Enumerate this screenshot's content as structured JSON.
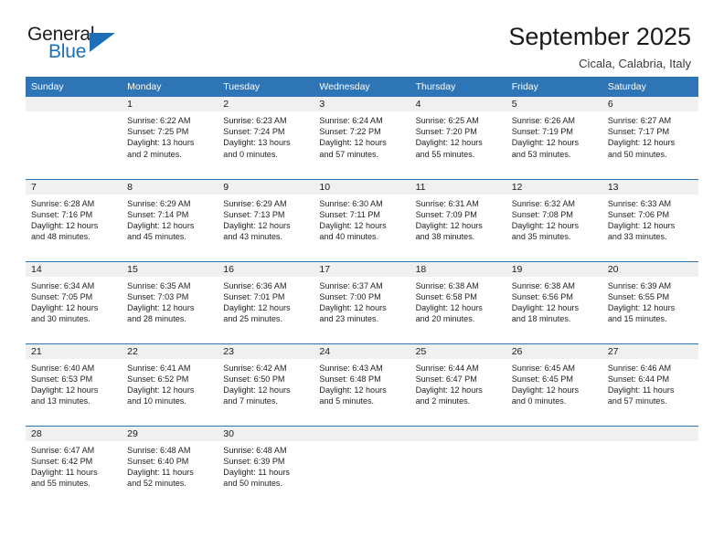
{
  "brand": {
    "name_part1": "General",
    "name_part2": "Blue",
    "accent_color": "#1d70b8"
  },
  "header": {
    "title": "September 2025",
    "subtitle": "Cicala, Calabria, Italy"
  },
  "theme": {
    "header_row_bg": "#2e75b6",
    "daynum_bg": "#f0f0f0",
    "grid_line": "#2e75b6"
  },
  "weekday_headers": [
    "Sunday",
    "Monday",
    "Tuesday",
    "Wednesday",
    "Thursday",
    "Friday",
    "Saturday"
  ],
  "labels": {
    "sunrise_prefix": "Sunrise:",
    "sunset_prefix": "Sunset:",
    "daylight_prefix": "Daylight:"
  },
  "weeks": [
    [
      {
        "day": "",
        "sunrise": "",
        "sunset": "",
        "daylight_line1": "",
        "daylight_line2": ""
      },
      {
        "day": "1",
        "sunrise": "Sunrise: 6:22 AM",
        "sunset": "Sunset: 7:25 PM",
        "daylight_line1": "Daylight: 13 hours",
        "daylight_line2": "and 2 minutes."
      },
      {
        "day": "2",
        "sunrise": "Sunrise: 6:23 AM",
        "sunset": "Sunset: 7:24 PM",
        "daylight_line1": "Daylight: 13 hours",
        "daylight_line2": "and 0 minutes."
      },
      {
        "day": "3",
        "sunrise": "Sunrise: 6:24 AM",
        "sunset": "Sunset: 7:22 PM",
        "daylight_line1": "Daylight: 12 hours",
        "daylight_line2": "and 57 minutes."
      },
      {
        "day": "4",
        "sunrise": "Sunrise: 6:25 AM",
        "sunset": "Sunset: 7:20 PM",
        "daylight_line1": "Daylight: 12 hours",
        "daylight_line2": "and 55 minutes."
      },
      {
        "day": "5",
        "sunrise": "Sunrise: 6:26 AM",
        "sunset": "Sunset: 7:19 PM",
        "daylight_line1": "Daylight: 12 hours",
        "daylight_line2": "and 53 minutes."
      },
      {
        "day": "6",
        "sunrise": "Sunrise: 6:27 AM",
        "sunset": "Sunset: 7:17 PM",
        "daylight_line1": "Daylight: 12 hours",
        "daylight_line2": "and 50 minutes."
      }
    ],
    [
      {
        "day": "7",
        "sunrise": "Sunrise: 6:28 AM",
        "sunset": "Sunset: 7:16 PM",
        "daylight_line1": "Daylight: 12 hours",
        "daylight_line2": "and 48 minutes."
      },
      {
        "day": "8",
        "sunrise": "Sunrise: 6:29 AM",
        "sunset": "Sunset: 7:14 PM",
        "daylight_line1": "Daylight: 12 hours",
        "daylight_line2": "and 45 minutes."
      },
      {
        "day": "9",
        "sunrise": "Sunrise: 6:29 AM",
        "sunset": "Sunset: 7:13 PM",
        "daylight_line1": "Daylight: 12 hours",
        "daylight_line2": "and 43 minutes."
      },
      {
        "day": "10",
        "sunrise": "Sunrise: 6:30 AM",
        "sunset": "Sunset: 7:11 PM",
        "daylight_line1": "Daylight: 12 hours",
        "daylight_line2": "and 40 minutes."
      },
      {
        "day": "11",
        "sunrise": "Sunrise: 6:31 AM",
        "sunset": "Sunset: 7:09 PM",
        "daylight_line1": "Daylight: 12 hours",
        "daylight_line2": "and 38 minutes."
      },
      {
        "day": "12",
        "sunrise": "Sunrise: 6:32 AM",
        "sunset": "Sunset: 7:08 PM",
        "daylight_line1": "Daylight: 12 hours",
        "daylight_line2": "and 35 minutes."
      },
      {
        "day": "13",
        "sunrise": "Sunrise: 6:33 AM",
        "sunset": "Sunset: 7:06 PM",
        "daylight_line1": "Daylight: 12 hours",
        "daylight_line2": "and 33 minutes."
      }
    ],
    [
      {
        "day": "14",
        "sunrise": "Sunrise: 6:34 AM",
        "sunset": "Sunset: 7:05 PM",
        "daylight_line1": "Daylight: 12 hours",
        "daylight_line2": "and 30 minutes."
      },
      {
        "day": "15",
        "sunrise": "Sunrise: 6:35 AM",
        "sunset": "Sunset: 7:03 PM",
        "daylight_line1": "Daylight: 12 hours",
        "daylight_line2": "and 28 minutes."
      },
      {
        "day": "16",
        "sunrise": "Sunrise: 6:36 AM",
        "sunset": "Sunset: 7:01 PM",
        "daylight_line1": "Daylight: 12 hours",
        "daylight_line2": "and 25 minutes."
      },
      {
        "day": "17",
        "sunrise": "Sunrise: 6:37 AM",
        "sunset": "Sunset: 7:00 PM",
        "daylight_line1": "Daylight: 12 hours",
        "daylight_line2": "and 23 minutes."
      },
      {
        "day": "18",
        "sunrise": "Sunrise: 6:38 AM",
        "sunset": "Sunset: 6:58 PM",
        "daylight_line1": "Daylight: 12 hours",
        "daylight_line2": "and 20 minutes."
      },
      {
        "day": "19",
        "sunrise": "Sunrise: 6:38 AM",
        "sunset": "Sunset: 6:56 PM",
        "daylight_line1": "Daylight: 12 hours",
        "daylight_line2": "and 18 minutes."
      },
      {
        "day": "20",
        "sunrise": "Sunrise: 6:39 AM",
        "sunset": "Sunset: 6:55 PM",
        "daylight_line1": "Daylight: 12 hours",
        "daylight_line2": "and 15 minutes."
      }
    ],
    [
      {
        "day": "21",
        "sunrise": "Sunrise: 6:40 AM",
        "sunset": "Sunset: 6:53 PM",
        "daylight_line1": "Daylight: 12 hours",
        "daylight_line2": "and 13 minutes."
      },
      {
        "day": "22",
        "sunrise": "Sunrise: 6:41 AM",
        "sunset": "Sunset: 6:52 PM",
        "daylight_line1": "Daylight: 12 hours",
        "daylight_line2": "and 10 minutes."
      },
      {
        "day": "23",
        "sunrise": "Sunrise: 6:42 AM",
        "sunset": "Sunset: 6:50 PM",
        "daylight_line1": "Daylight: 12 hours",
        "daylight_line2": "and 7 minutes."
      },
      {
        "day": "24",
        "sunrise": "Sunrise: 6:43 AM",
        "sunset": "Sunset: 6:48 PM",
        "daylight_line1": "Daylight: 12 hours",
        "daylight_line2": "and 5 minutes."
      },
      {
        "day": "25",
        "sunrise": "Sunrise: 6:44 AM",
        "sunset": "Sunset: 6:47 PM",
        "daylight_line1": "Daylight: 12 hours",
        "daylight_line2": "and 2 minutes."
      },
      {
        "day": "26",
        "sunrise": "Sunrise: 6:45 AM",
        "sunset": "Sunset: 6:45 PM",
        "daylight_line1": "Daylight: 12 hours",
        "daylight_line2": "and 0 minutes."
      },
      {
        "day": "27",
        "sunrise": "Sunrise: 6:46 AM",
        "sunset": "Sunset: 6:44 PM",
        "daylight_line1": "Daylight: 11 hours",
        "daylight_line2": "and 57 minutes."
      }
    ],
    [
      {
        "day": "28",
        "sunrise": "Sunrise: 6:47 AM",
        "sunset": "Sunset: 6:42 PM",
        "daylight_line1": "Daylight: 11 hours",
        "daylight_line2": "and 55 minutes."
      },
      {
        "day": "29",
        "sunrise": "Sunrise: 6:48 AM",
        "sunset": "Sunset: 6:40 PM",
        "daylight_line1": "Daylight: 11 hours",
        "daylight_line2": "and 52 minutes."
      },
      {
        "day": "30",
        "sunrise": "Sunrise: 6:48 AM",
        "sunset": "Sunset: 6:39 PM",
        "daylight_line1": "Daylight: 11 hours",
        "daylight_line2": "and 50 minutes."
      },
      {
        "day": "",
        "sunrise": "",
        "sunset": "",
        "daylight_line1": "",
        "daylight_line2": ""
      },
      {
        "day": "",
        "sunrise": "",
        "sunset": "",
        "daylight_line1": "",
        "daylight_line2": ""
      },
      {
        "day": "",
        "sunrise": "",
        "sunset": "",
        "daylight_line1": "",
        "daylight_line2": ""
      },
      {
        "day": "",
        "sunrise": "",
        "sunset": "",
        "daylight_line1": "",
        "daylight_line2": ""
      }
    ]
  ]
}
